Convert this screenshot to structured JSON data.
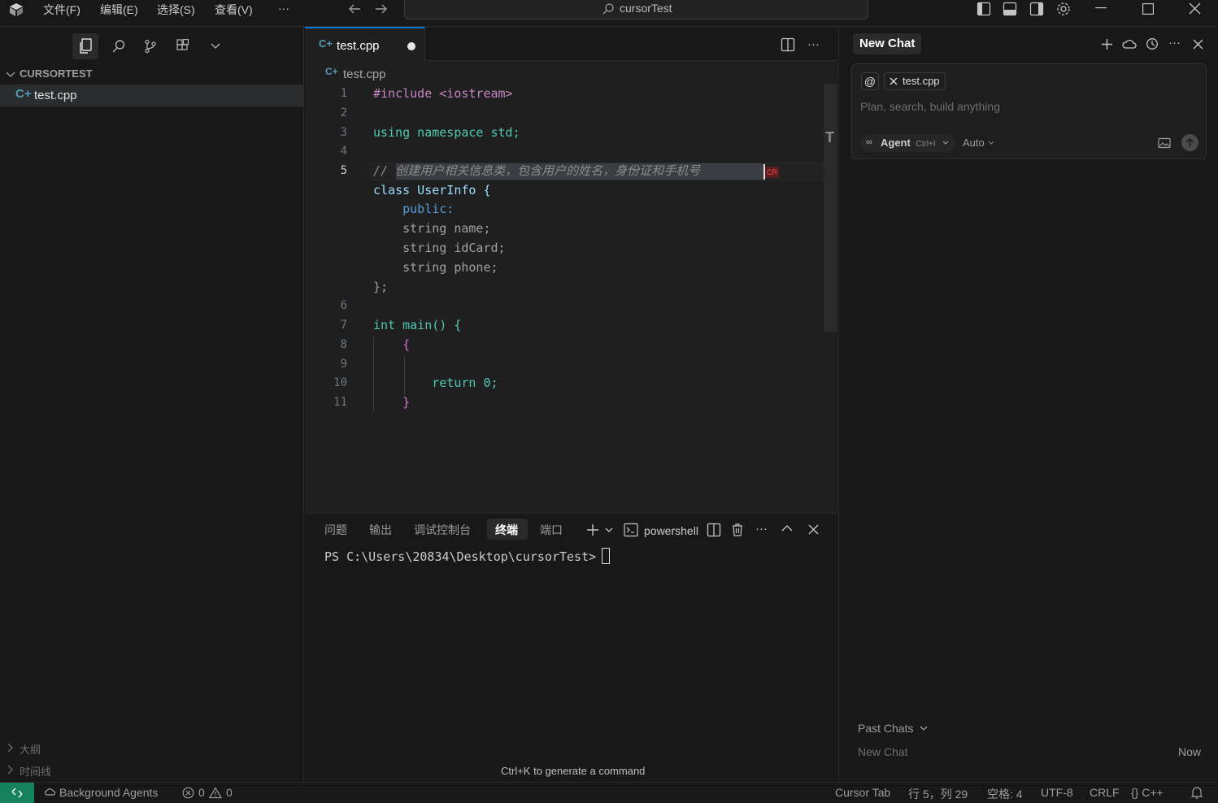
{
  "titlebar": {
    "menus": [
      "文件(F)",
      "编辑(E)",
      "选择(S)",
      "查看(V)",
      "···"
    ],
    "search_text": "cursorTest"
  },
  "sidebar": {
    "section_title": "CURSORTEST",
    "files": [
      {
        "name": "test.cpp",
        "selected": true
      }
    ],
    "bottom_sections": [
      "大纲",
      "时间线"
    ]
  },
  "editor": {
    "tab_label": "test.cpp",
    "breadcrumb": "test.cpp",
    "lines": [
      {
        "num": "1",
        "text": "#include <iostream>"
      },
      {
        "num": "2",
        "text": ""
      },
      {
        "num": "3",
        "text": "using namespace std;"
      },
      {
        "num": "4",
        "text": ""
      },
      {
        "num": "5",
        "text": "// 创建用户相关信息类，包含用户的姓名，身份证和手机号"
      },
      {
        "num": "",
        "text": "class UserInfo {"
      },
      {
        "num": "",
        "text": "    public:"
      },
      {
        "num": "",
        "text": "    string name;"
      },
      {
        "num": "",
        "text": "    string idCard;"
      },
      {
        "num": "",
        "text": "    string phone;"
      },
      {
        "num": "",
        "text": "};"
      },
      {
        "num": "6",
        "text": ""
      },
      {
        "num": "7",
        "text": "int main() {"
      },
      {
        "num": "8",
        "text": "    {"
      },
      {
        "num": "9",
        "text": ""
      },
      {
        "num": "10",
        "text": "        return 0;"
      },
      {
        "num": "11",
        "text": "    }"
      }
    ],
    "cr_marker": "CR"
  },
  "panel": {
    "tabs": [
      "问题",
      "输出",
      "调试控制台",
      "终端",
      "端口"
    ],
    "active_tab": "终端",
    "shell_label": "powershell",
    "prompt": "PS C:\\Users\\20834\\Desktop\\cursorTest> ",
    "hint": "Ctrl+K to generate a command"
  },
  "chat": {
    "title": "New Chat",
    "context_chip": "test.cpp",
    "placeholder": "Plan, search, build anything",
    "mode_label": "Agent",
    "mode_shortcut": "Ctrl+I",
    "model_label": "Auto",
    "past_chats_label": "Past Chats",
    "history": [
      {
        "title": "New Chat",
        "time": "Now"
      }
    ]
  },
  "statusbar": {
    "background_agents": "Background Agents",
    "errors": "0",
    "warnings": "0",
    "cursor_tab": "Cursor Tab",
    "position": "行 5，列 29",
    "spaces": "空格: 4",
    "encoding": "UTF-8",
    "eol": "CRLF",
    "language": "{} C++"
  },
  "colors": {
    "accent": "#0078d4",
    "remote": "#16825d",
    "comment": "#6a9955"
  }
}
